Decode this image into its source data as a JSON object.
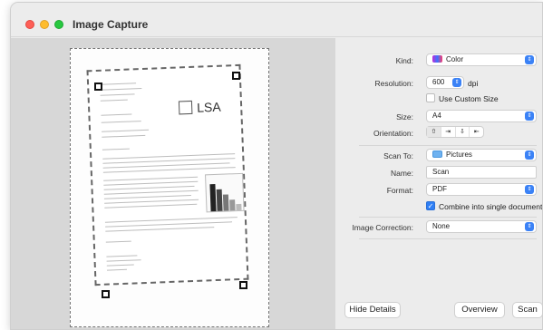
{
  "window": {
    "title": "Image Capture"
  },
  "settings": {
    "kind_label": "Kind:",
    "kind_value": "Color",
    "resolution_label": "Resolution:",
    "resolution_value": "600",
    "resolution_unit": "dpi",
    "custom_size_label": "Use Custom Size",
    "size_label": "Size:",
    "size_value": "A4",
    "orientation_label": "Orientation:",
    "orientation_options": [
      "⇧",
      "⇥",
      "⇩",
      "⇤"
    ],
    "scan_to_label": "Scan To:",
    "scan_to_value": "Pictures",
    "name_label": "Name:",
    "name_value": "Scan",
    "format_label": "Format:",
    "format_value": "PDF",
    "combine_label": "Combine into single document",
    "correction_label": "Image Correction:",
    "correction_value": "None"
  },
  "buttons": {
    "hide_details": "Hide Details",
    "overview": "Overview",
    "scan": "Scan"
  },
  "document": {
    "logo_text": "LSA"
  },
  "colors": {
    "accent": "#2f7ff5",
    "red": "#fe5f57",
    "yellow": "#febc2e",
    "green": "#28c840"
  },
  "state": {
    "custom_size_checked": false,
    "combine_checked": true
  }
}
